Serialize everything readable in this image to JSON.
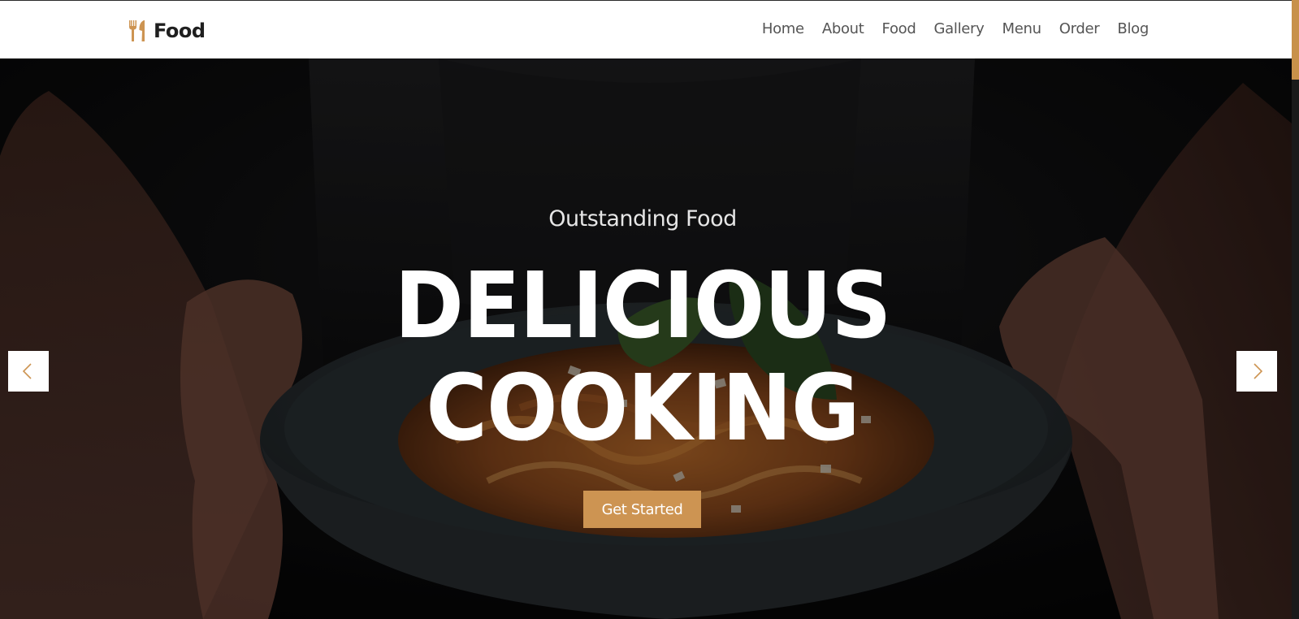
{
  "header": {
    "brand_name": "Food",
    "brand_icon": "fork-knife-icon",
    "nav": [
      {
        "label": "Home"
      },
      {
        "label": "About"
      },
      {
        "label": "Food"
      },
      {
        "label": "Gallery"
      },
      {
        "label": "Menu"
      },
      {
        "label": "Order"
      },
      {
        "label": "Blog"
      }
    ]
  },
  "hero": {
    "subtitle": "Outstanding Food",
    "title_line_1": "DELICIOUS",
    "title_line_2": "COOKING",
    "cta_label": "Get Started",
    "prev_icon": "chevron-left-icon",
    "next_icon": "chevron-right-icon"
  },
  "colors": {
    "accent": "#cd9452",
    "header_bg": "#ffffff",
    "nav_text": "#555555",
    "brand_text": "#1f1f1f",
    "hero_text": "#ffffff"
  }
}
